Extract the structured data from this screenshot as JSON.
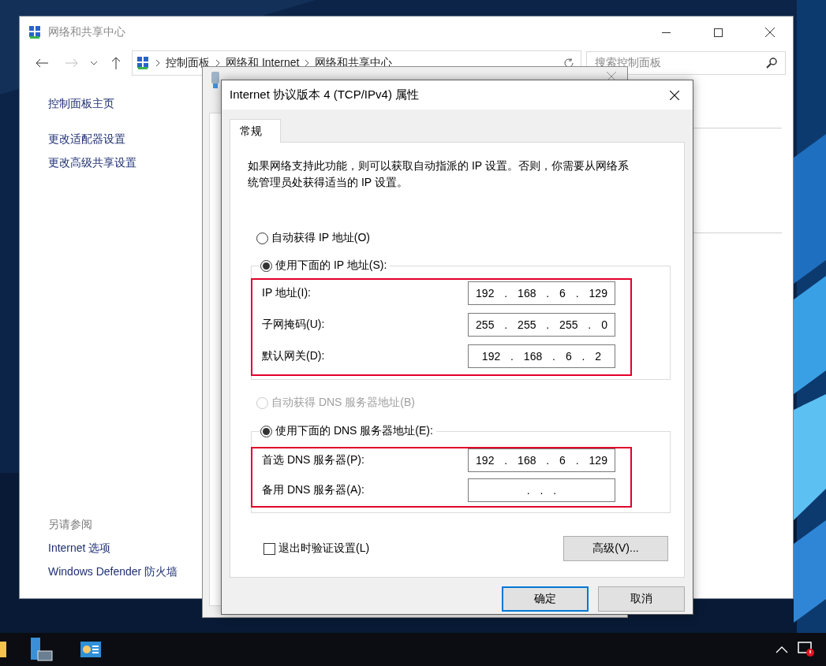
{
  "control_panel": {
    "title": "网络和共享中心",
    "breadcrumb": [
      "控制面板",
      "网络和 Internet",
      "网络和共享中心"
    ],
    "search": {
      "placeholder": "搜索控制面板"
    },
    "sidebar": {
      "links": [
        "控制面板主页",
        "更改适配器设置",
        "更改高级共享设置"
      ],
      "see_also_heading": "另请参阅",
      "see_also": [
        "Internet 选项",
        "Windows Defender 防火墙"
      ]
    }
  },
  "ipv4_dialog": {
    "title": "Internet 协议版本 4 (TCP/IPv4) 属性",
    "tabs": [
      {
        "label": "常规",
        "selected": true
      }
    ],
    "description": "如果网络支持此功能，则可以获取自动指派的 IP 设置。否则，你需要从网络系统管理员处获得适当的 IP 设置。",
    "ip_options": [
      {
        "label": "自动获得 IP 地址(O)",
        "selected": false,
        "disabled": false
      },
      {
        "label": "使用下面的 IP 地址(S):",
        "selected": true,
        "disabled": false
      }
    ],
    "ip_fields_highlighted": true,
    "ip_fields": [
      {
        "label": "IP 地址(I):",
        "value": "192 . 168 . 6 . 129"
      },
      {
        "label": "子网掩码(U):",
        "value": "255 . 255 . 255 . 0"
      },
      {
        "label": "默认网关(D):",
        "value": "192 . 168 . 6 . 2"
      }
    ],
    "dns_options": [
      {
        "label": "自动获得 DNS 服务器地址(B)",
        "selected": false,
        "disabled": true
      },
      {
        "label": "使用下面的 DNS 服务器地址(E):",
        "selected": true,
        "disabled": false
      }
    ],
    "dns_fields_highlighted": true,
    "dns_fields": [
      {
        "label": "首选 DNS 服务器(P):",
        "value": "192 . 168 . 6 . 129"
      },
      {
        "label": "备用 DNS 服务器(A):",
        "value": ". . ."
      }
    ],
    "validate_on_exit": {
      "label": "退出时验证设置(L)",
      "checked": false
    },
    "advanced_button": "高级(V)...",
    "buttons": [
      {
        "label": "确定",
        "default": true
      },
      {
        "label": "取消",
        "default": false
      }
    ]
  }
}
